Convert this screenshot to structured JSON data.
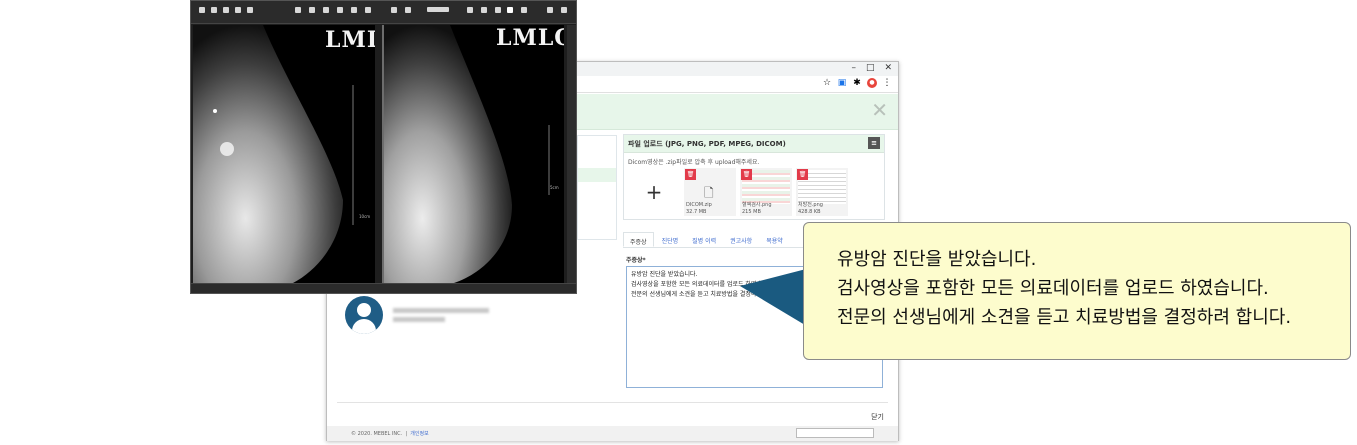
{
  "browser": {
    "window_controls": [
      "–",
      "□",
      "✕"
    ]
  },
  "modal": {
    "close_symbol": "✕"
  },
  "upload": {
    "title": "파일 업로드 (JPG, PNG, PDF, MPEG, DICOM)",
    "note": "Dicom영상은 .zip파일로 압축 후 upload해주세요.",
    "add_symbol": "+",
    "files": [
      {
        "name": "DICOM.zip",
        "size": "32.7 MB"
      },
      {
        "name": "혈액검사.png",
        "size": "215 MB"
      },
      {
        "name": "처방전.png",
        "size": "428.8 KB"
      }
    ]
  },
  "tabs": [
    "주증상",
    "진단명",
    "질병 이력",
    "권고사항",
    "복용약"
  ],
  "form": {
    "label": "주증상*",
    "textarea_lines": [
      "유방암 진단을 받았습니다.",
      "검사영상을 포함한 모든 의료데이터를 업로드 하였습니다.",
      "전문의 선생님에게 소견을 듣고 치료방법을 결정하려 합니다."
    ]
  },
  "footer": {
    "close_label": "닫기",
    "copyright": "© 2020. MEBEL INC.",
    "privacy": "개인정보"
  },
  "viewer": {
    "left_label": "LMLO",
    "right_label": "LMLO",
    "left_scale": "10cm",
    "right_scale": "5cm"
  },
  "callout": {
    "lines": [
      "유방암 진단을 받았습니다.",
      "검사영상을 포함한 모든 의료데이터를 업로드 하였습니다.",
      "전문의 선생님에게 소견을 듣고 치료방법을 결정하려 합니다."
    ]
  },
  "colors": {
    "header_green": "#e7f6ea",
    "avatar_blue": "#1f5d86",
    "delete_red": "#e23b4a",
    "callout_bg": "#fdfccd",
    "tail_blue": "#1a5a80"
  },
  "icons": [
    "close-icon",
    "trash-icon",
    "file-icon",
    "plus-icon",
    "user-avatar-icon",
    "menu-icon"
  ]
}
